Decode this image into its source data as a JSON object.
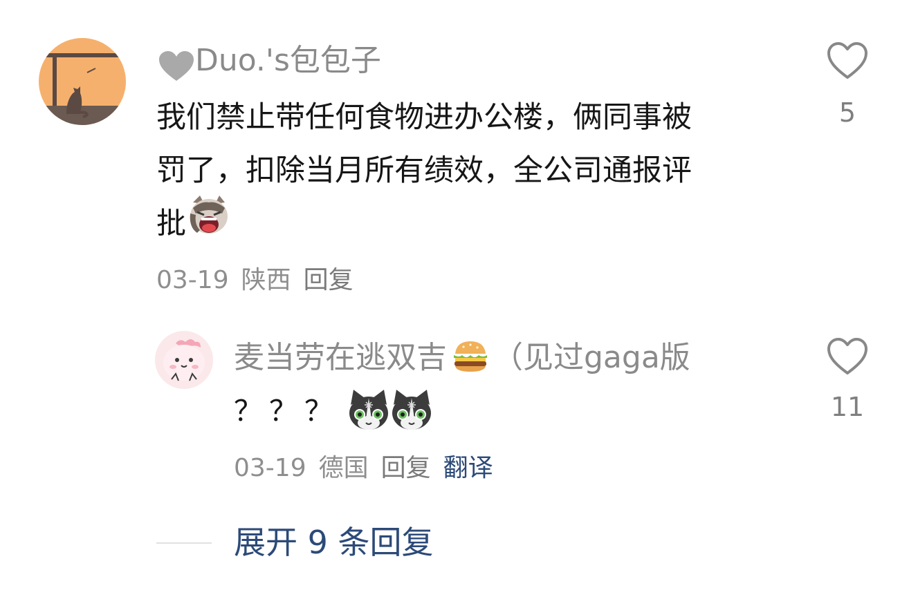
{
  "comments": [
    {
      "user": "Duo.'s包包子",
      "text_line1": "我们禁止带任何食物进办公楼，俩同事被",
      "text_line2": "罚了，扣除当月所有绩效，全公司通报评",
      "text_line3": "批",
      "date": "03-19",
      "location": "陕西",
      "reply_label": "回复",
      "likes": "5",
      "name_icon": "grey-heart-icon",
      "emoji": "crying-cat-emoji"
    },
    {
      "user": "麦当劳在逃双吉",
      "user_suffix": "（见过gaga版",
      "text": "？？？",
      "date": "03-19",
      "location": "德国",
      "reply_label": "回复",
      "translate_label": "翻译",
      "likes": "11",
      "name_icon": "burger-emoji",
      "emoji": "tuxedo-cat-emoji"
    }
  ],
  "expand": {
    "label": "展开 9 条回复"
  },
  "colors": {
    "link": "#2c4a78",
    "muted": "#8e8e8e",
    "text": "#161616"
  }
}
